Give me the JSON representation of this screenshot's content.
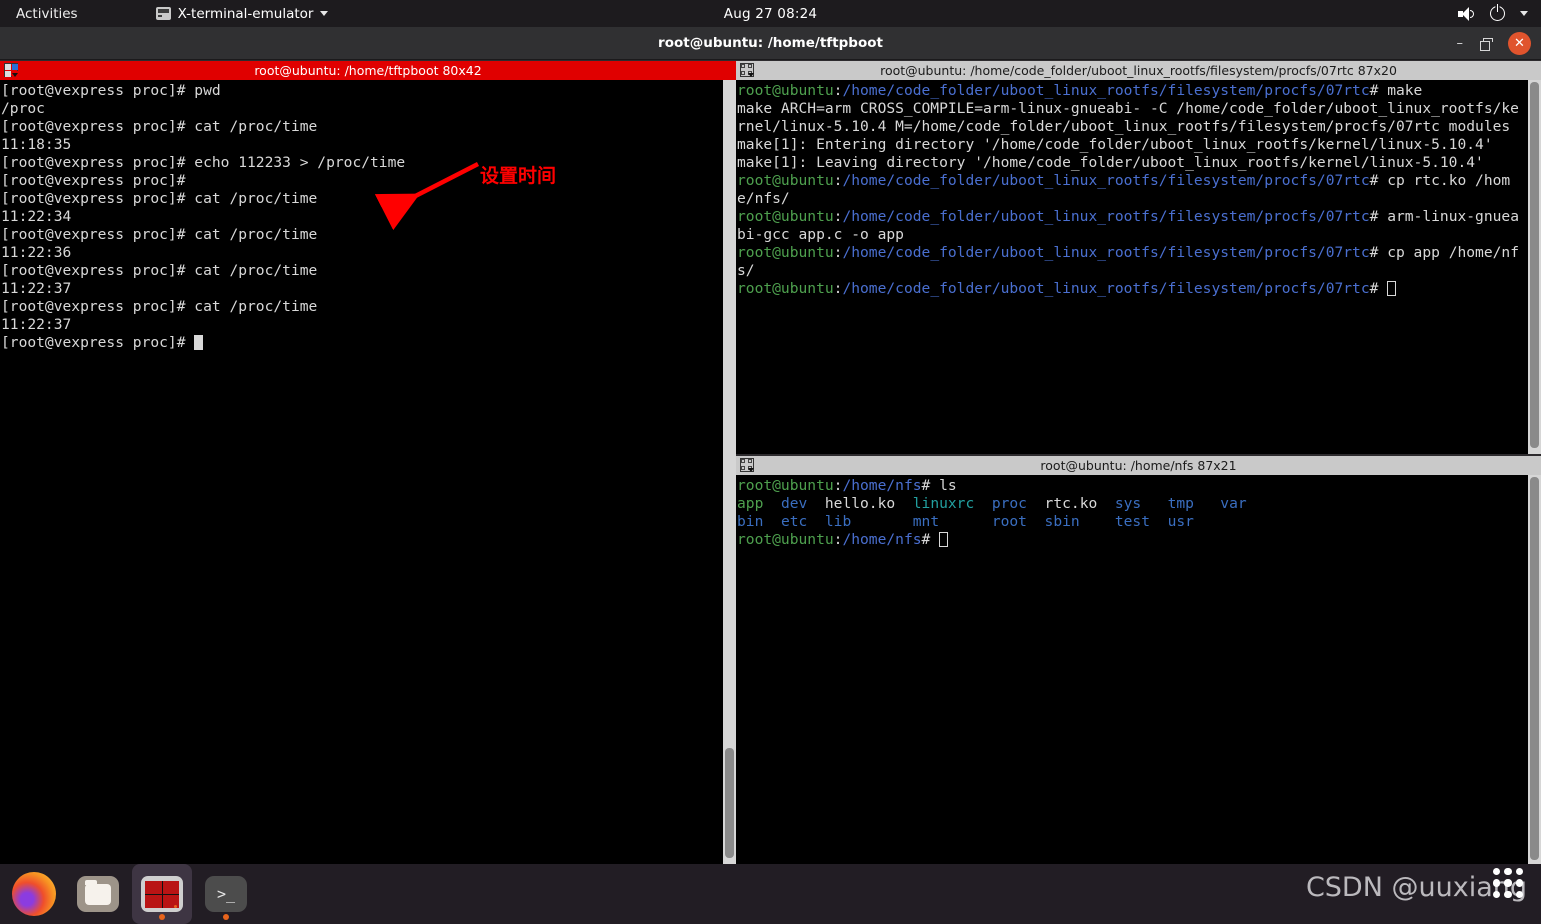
{
  "topbar": {
    "activities": "Activities",
    "app_name": "X-terminal-emulator",
    "clock": "Aug 27  08:24",
    "icons": {
      "app": "terminal-icon",
      "caret": "chevron-down-icon",
      "volume": "volume-icon",
      "power": "power-icon",
      "menu": "chevron-down-icon"
    }
  },
  "window": {
    "title": "root@ubuntu: /home/tftpboot",
    "minimize": "–",
    "maximize": "restore-icon",
    "close": "✕"
  },
  "panes": {
    "left": {
      "title": "root@ubuntu: /home/tftpboot 80x42",
      "active": true,
      "lines": [
        {
          "parts": [
            {
              "t": "[root@vexpress proc]# pwd",
              "c": "w"
            }
          ]
        },
        {
          "parts": [
            {
              "t": "/proc",
              "c": "w"
            }
          ]
        },
        {
          "parts": [
            {
              "t": "[root@vexpress proc]# cat /proc/time",
              "c": "w"
            }
          ]
        },
        {
          "parts": [
            {
              "t": "11:18:35",
              "c": "w"
            }
          ]
        },
        {
          "parts": [
            {
              "t": "[root@vexpress proc]# echo 112233 > /proc/time",
              "c": "w"
            }
          ]
        },
        {
          "parts": [
            {
              "t": "[root@vexpress proc]#",
              "c": "w"
            }
          ]
        },
        {
          "parts": [
            {
              "t": "[root@vexpress proc]# cat /proc/time",
              "c": "w"
            }
          ]
        },
        {
          "parts": [
            {
              "t": "11:22:34",
              "c": "w"
            }
          ]
        },
        {
          "parts": [
            {
              "t": "[root@vexpress proc]# cat /proc/time",
              "c": "w"
            }
          ]
        },
        {
          "parts": [
            {
              "t": "11:22:36",
              "c": "w"
            }
          ]
        },
        {
          "parts": [
            {
              "t": "[root@vexpress proc]# cat /proc/time",
              "c": "w"
            }
          ]
        },
        {
          "parts": [
            {
              "t": "11:22:37",
              "c": "w"
            }
          ]
        },
        {
          "parts": [
            {
              "t": "[root@vexpress proc]# cat /proc/time",
              "c": "w"
            }
          ]
        },
        {
          "parts": [
            {
              "t": "11:22:37",
              "c": "w"
            }
          ]
        },
        {
          "parts": [
            {
              "t": "[root@vexpress proc]# ",
              "c": "w"
            },
            {
              "t": "",
              "c": "cursor"
            }
          ]
        }
      ]
    },
    "right_top": {
      "title": "root@ubuntu: /home/code_folder/uboot_linux_rootfs/filesystem/procfs/07rtc 87x20",
      "active": false,
      "lines": [
        {
          "parts": [
            {
              "t": "root@ubuntu",
              "c": "g"
            },
            {
              "t": ":",
              "c": "w"
            },
            {
              "t": "/home/code_folder/uboot_linux_rootfs/filesystem/procfs/07rtc",
              "c": "b"
            },
            {
              "t": "# make",
              "c": "w"
            }
          ]
        },
        {
          "parts": [
            {
              "t": "make ARCH=arm CROSS_COMPILE=arm-linux-gnueabi- -C /home/code_folder/uboot_linux_rootfs/kernel/linux-5.10.4 M=/home/code_folder/uboot_linux_rootfs/filesystem/procfs/07rtc modules",
              "c": "w"
            }
          ]
        },
        {
          "parts": [
            {
              "t": "make[1]: Entering directory '/home/code_folder/uboot_linux_rootfs/kernel/linux-5.10.4'",
              "c": "w"
            }
          ]
        },
        {
          "parts": [
            {
              "t": "make[1]: Leaving directory '/home/code_folder/uboot_linux_rootfs/kernel/linux-5.10.4'",
              "c": "w"
            }
          ]
        },
        {
          "parts": [
            {
              "t": "root@ubuntu",
              "c": "g"
            },
            {
              "t": ":",
              "c": "w"
            },
            {
              "t": "/home/code_folder/uboot_linux_rootfs/filesystem/procfs/07rtc",
              "c": "b"
            },
            {
              "t": "# cp rtc.ko /home/nfs/",
              "c": "w"
            }
          ]
        },
        {
          "parts": [
            {
              "t": "root@ubuntu",
              "c": "g"
            },
            {
              "t": ":",
              "c": "w"
            },
            {
              "t": "/home/code_folder/uboot_linux_rootfs/filesystem/procfs/07rtc",
              "c": "b"
            },
            {
              "t": "# arm-linux-gnueabi-gcc app.c -o app",
              "c": "w"
            }
          ]
        },
        {
          "parts": [
            {
              "t": "root@ubuntu",
              "c": "g"
            },
            {
              "t": ":",
              "c": "w"
            },
            {
              "t": "/home/code_folder/uboot_linux_rootfs/filesystem/procfs/07rtc",
              "c": "b"
            },
            {
              "t": "# cp app /home/nfs/",
              "c": "w"
            }
          ]
        },
        {
          "parts": [
            {
              "t": "root@ubuntu",
              "c": "g"
            },
            {
              "t": ":",
              "c": "w"
            },
            {
              "t": "/home/code_folder/uboot_linux_rootfs/filesystem/procfs/07rtc",
              "c": "b"
            },
            {
              "t": "# ",
              "c": "w"
            },
            {
              "t": "",
              "c": "cursor-hollow"
            }
          ]
        }
      ]
    },
    "right_bottom": {
      "title": "root@ubuntu: /home/nfs 87x21",
      "active": false,
      "lines": [
        {
          "parts": [
            {
              "t": "root@ubuntu",
              "c": "g"
            },
            {
              "t": ":",
              "c": "w"
            },
            {
              "t": "/home/nfs",
              "c": "b"
            },
            {
              "t": "# ls",
              "c": "w"
            }
          ]
        }
      ],
      "ls_columns": [
        [
          {
            "name": "app",
            "type": "exec"
          },
          {
            "name": "bin",
            "type": "dir"
          }
        ],
        [
          {
            "name": "dev",
            "type": "dir"
          },
          {
            "name": "etc",
            "type": "dir"
          }
        ],
        [
          {
            "name": "hello.ko",
            "type": "file"
          },
          {
            "name": "lib",
            "type": "dir"
          }
        ],
        [
          {
            "name": "linuxrc",
            "type": "link"
          },
          {
            "name": "mnt",
            "type": "dir"
          }
        ],
        [
          {
            "name": "proc",
            "type": "dir"
          },
          {
            "name": "root",
            "type": "dir"
          }
        ],
        [
          {
            "name": "rtc.ko",
            "type": "file"
          },
          {
            "name": "sbin",
            "type": "dir"
          }
        ],
        [
          {
            "name": "sys",
            "type": "dir"
          },
          {
            "name": "test",
            "type": "dir"
          }
        ],
        [
          {
            "name": "tmp",
            "type": "dir"
          },
          {
            "name": "usr",
            "type": "dir"
          }
        ],
        [
          {
            "name": "var",
            "type": "dir"
          },
          {
            "name": "",
            "type": "none"
          }
        ]
      ],
      "prompt_tail": {
        "user": "root@ubuntu",
        "sep": ":",
        "path": "/home/nfs",
        "sym": "# "
      }
    }
  },
  "annotation": {
    "text": "设置时间",
    "color": "#ff0000",
    "arrow": "red-arrow-annotation"
  },
  "dock": {
    "items": [
      {
        "name": "firefox",
        "label": "Firefox",
        "running": false,
        "active": false
      },
      {
        "name": "files",
        "label": "Files",
        "running": false,
        "active": false
      },
      {
        "name": "terminator",
        "label": "Terminator",
        "running": true,
        "active": true
      },
      {
        "name": "terminal",
        "label": "Terminal",
        "running": true,
        "active": false
      }
    ],
    "show_apps": "show-applications-grid"
  },
  "watermark": "CSDN @uuxiang",
  "colors": {
    "active_titlebar": "#e00000",
    "inactive_titlebar": "#c9c9c9",
    "terminal_bg": "#000000",
    "prompt_green": "#4ea04e",
    "path_blue": "#4a6fd0",
    "dir_blue": "#3a6ec0",
    "link_cyan": "#22a0a0",
    "close_orange": "#e0542d"
  }
}
